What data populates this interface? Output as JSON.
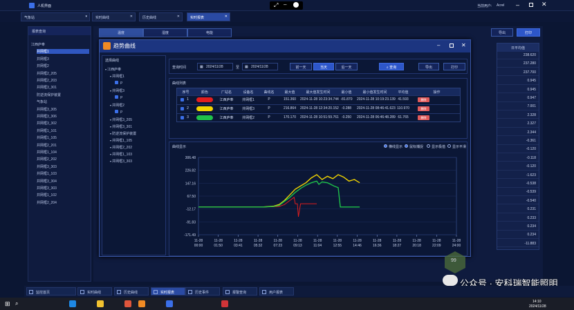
{
  "window": {
    "title": "人机界面",
    "user_label": "当前用户:",
    "user": "Acrel"
  },
  "tabs": {
    "station": "气象站",
    "items": [
      "实时曲线",
      "历史曲线",
      "实时报表"
    ]
  },
  "left": {
    "header": "报表查询",
    "items": [
      "江西庐奉",
      "井网框1",
      "井网框3",
      "井网框2",
      "井网框2_205",
      "井网框2_203",
      "井网框3_301",
      "防逆流保护装置",
      "气象站",
      "井网框3_305",
      "井网框3_306",
      "井网框3_302",
      "井网框1_101",
      "井网框1_105",
      "井网框2_201",
      "井网框1_104",
      "井网框2_202",
      "井网框3_303",
      "井网框1_103",
      "井网框3_304",
      "井网框3_303",
      "井网框1_102",
      "井网框2_204"
    ]
  },
  "main": {
    "subtabs": [
      "温度",
      "湿度",
      "电能"
    ],
    "export": "导出",
    "print": "打印",
    "col_header": "日平均值",
    "right_values": [
      "238.620",
      "237.280",
      "237.700",
      "0.945",
      "0.945",
      "0.947",
      "7.001",
      "2.328",
      "2.327",
      "2.344",
      "-0.361",
      "-0.120",
      "-0.118",
      "-0.120",
      "-1.623",
      "-0.538",
      "-0.539",
      "-0.540",
      "0.231",
      "0.233",
      "0.234",
      "0.234",
      "-11.883"
    ]
  },
  "modal": {
    "title": "趋势曲线",
    "tree_header": "选择曲线",
    "tree": [
      "江西庐奉",
      "井网框1",
      "P",
      "井网框3",
      "P",
      "井网框2",
      "P",
      "井网框3_205",
      "井网框3_301",
      "防逆流保护装置",
      "井网框1_105",
      "井网框2_202",
      "井网框1_103",
      "井网框3_303"
    ],
    "query_label": "查询时间",
    "date_start": "2024/11/28",
    "to": "至",
    "date_end": "2024/11/28",
    "prev": "前一天",
    "today": "当天",
    "next": "后一天",
    "search": "查询",
    "export": "导出",
    "print": "打印",
    "list_title": "曲线列表",
    "headers": [
      "序号",
      "颜色",
      "厂站名",
      "设备名",
      "曲线名",
      "最大值",
      "最大值发生时间",
      "最小值",
      "最小值发生时间",
      "平均值",
      "操作"
    ],
    "rows": [
      {
        "no": "1",
        "color": "#e21e1e",
        "station": "江西庐奉",
        "device": "井网框1",
        "curve": "P",
        "max": "151.360",
        "max_time": "2024-11-28 10:23:34.744",
        "min": "-81.870",
        "min_time": "2024-11-28 10:19:23.139",
        "avg": "41.593",
        "op": "删除"
      },
      {
        "no": "2",
        "color": "#f2d500",
        "station": "江西庐奉",
        "device": "井网框3",
        "curve": "P",
        "max": "216.864",
        "max_time": "2024-11-28 12:34:20.152",
        "min": "-0.288",
        "min_time": "2024-11-28 08:46:41.623",
        "avg": "110.970",
        "op": "删除"
      },
      {
        "no": "3",
        "color": "#1fc24a",
        "station": "江西庐奉",
        "device": "井网框2",
        "curve": "P",
        "max": "170.170",
        "max_time": "2024-11-28 10:51:59.761",
        "min": "-0.250",
        "min_time": "2024-11-28 06:46:48.289",
        "avg": "61.765",
        "op": "删除"
      }
    ],
    "chart_title": "曲线显示",
    "options": [
      "横线显示",
      "鼠标捕捉",
      "显示极值",
      "显示平滑"
    ]
  },
  "chart_data": {
    "type": "line",
    "ylim": [
      -171.49,
      306.48
    ],
    "yticks": [
      "306.48",
      "226.82",
      "147.16",
      "67.50",
      "-12.17",
      "-91.83",
      "-171.49"
    ],
    "xticks": [
      [
        "11-28",
        "00:00"
      ],
      [
        "11-28",
        "01:50"
      ],
      [
        "11-28",
        "03:41"
      ],
      [
        "11-28",
        "05:32"
      ],
      [
        "11-28",
        "07:23"
      ],
      [
        "11-28",
        "09:13"
      ],
      [
        "11-28",
        "11:04"
      ],
      [
        "11-28",
        "12:55"
      ],
      [
        "11-28",
        "14:46"
      ],
      [
        "11-28",
        "16:36"
      ],
      [
        "11-28",
        "18:27"
      ],
      [
        "11-28",
        "20:18"
      ],
      [
        "11-28",
        "22:09"
      ],
      [
        "11-28",
        "24:00"
      ]
    ],
    "series": [
      {
        "color": "#e21e1e",
        "x": [
          0,
          1,
          2,
          3,
          4,
          5,
          6,
          7.5,
          8,
          8.5,
          8.9,
          9.0,
          9.1,
          9.2,
          9.3,
          9.5,
          9.8,
          10,
          10.2,
          10.3,
          10.4,
          10.6,
          11
        ],
        "y": [
          0,
          0,
          0,
          0,
          0,
          0,
          0,
          3,
          15,
          40,
          60,
          20,
          20,
          20,
          -60,
          20,
          20,
          20,
          20,
          20,
          20,
          20,
          20
        ]
      },
      {
        "color": "#f2d500",
        "x": [
          0,
          6,
          7,
          7.5,
          8,
          8.5,
          9,
          9.5,
          10,
          10.5,
          11,
          11.5,
          12,
          12.5,
          13,
          13.5,
          14,
          14.5,
          15
        ],
        "y": [
          0,
          0,
          5,
          15,
          40,
          75,
          110,
          130,
          150,
          180,
          200,
          170,
          190,
          175,
          200,
          185,
          160,
          170,
          150
        ]
      },
      {
        "color": "#1fc24a",
        "x": [
          0,
          6,
          7,
          7.5,
          8,
          8.5,
          9,
          9.5,
          10,
          10.5,
          11,
          11.2,
          11.5,
          12,
          12.3,
          12.6,
          13,
          13.2,
          13.5,
          15
        ],
        "y": [
          0,
          0,
          3,
          10,
          35,
          60,
          90,
          115,
          135,
          150,
          160,
          140,
          155,
          150,
          140,
          130,
          120,
          0,
          0,
          0
        ]
      }
    ],
    "xmax": 24
  },
  "bottom": {
    "tabs": [
      "监控首页",
      "实时曲线",
      "历史曲线",
      "实时报表",
      "历史事件",
      "报警查询",
      "用户报表"
    ]
  },
  "taskbar": {
    "time": "14:10",
    "date": "2024/11/28"
  },
  "watermark": {
    "text": "公众号 · 安科瑞智能照明",
    "badge": "99"
  }
}
